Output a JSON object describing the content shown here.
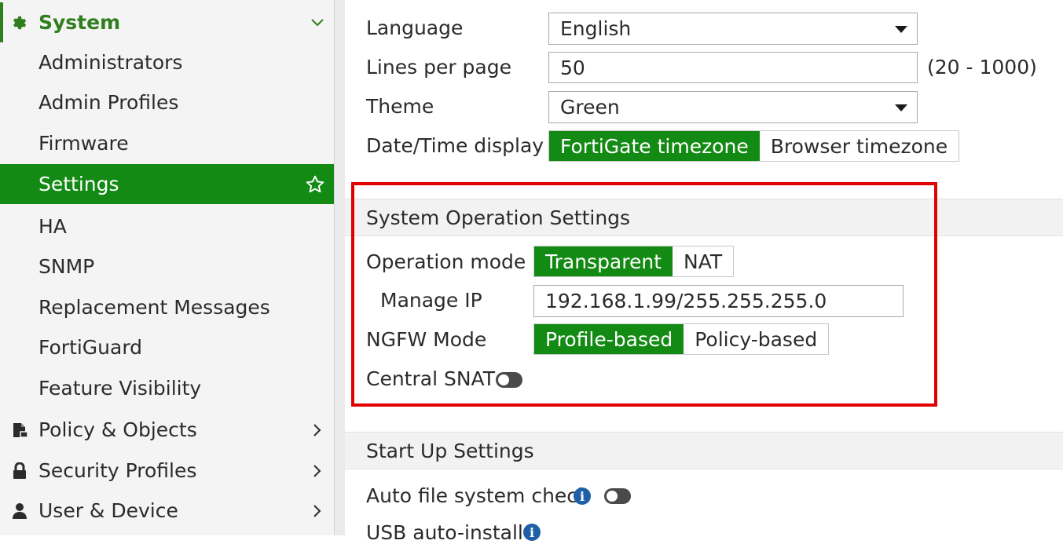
{
  "sidebar": {
    "system": {
      "label": "System",
      "icon": "gear-icon"
    },
    "items": [
      {
        "label": "Administrators"
      },
      {
        "label": "Admin Profiles"
      },
      {
        "label": "Firmware"
      },
      {
        "label": "Settings",
        "active": true
      },
      {
        "label": "HA"
      },
      {
        "label": "SNMP"
      },
      {
        "label": "Replacement Messages"
      },
      {
        "label": "FortiGuard"
      },
      {
        "label": "Feature Visibility"
      }
    ],
    "groups": [
      {
        "label": "Policy & Objects",
        "icon": "policy-icon"
      },
      {
        "label": "Security Profiles",
        "icon": "lock-icon"
      },
      {
        "label": "User & Device",
        "icon": "user-icon"
      }
    ]
  },
  "settings": {
    "language": {
      "label": "Language",
      "value": "English"
    },
    "lines_per_page": {
      "label": "Lines per page",
      "value": "50",
      "range": "(20 - 1000)"
    },
    "theme": {
      "label": "Theme",
      "value": "Green"
    },
    "datetime": {
      "label": "Date/Time display",
      "options": [
        "FortiGate timezone",
        "Browser timezone"
      ],
      "selected": "FortiGate timezone"
    }
  },
  "system_operation": {
    "title": "System Operation Settings",
    "operation_mode": {
      "label": "Operation mode",
      "options": [
        "Transparent",
        "NAT"
      ],
      "selected": "Transparent"
    },
    "manage_ip": {
      "label": "Manage IP",
      "value": "192.168.1.99/255.255.255.0"
    },
    "ngfw_mode": {
      "label": "NGFW Mode",
      "options": [
        "Profile-based",
        "Policy-based"
      ],
      "selected": "Profile-based"
    },
    "central_snat": {
      "label": "Central SNAT",
      "enabled": false
    }
  },
  "startup": {
    "title": "Start Up Settings",
    "auto_fs_check": {
      "label": "Auto file system check",
      "enabled": false
    },
    "usb_auto_install": {
      "label": "USB auto-install"
    }
  },
  "colors": {
    "accent": "#138a13",
    "highlight": "#e00000",
    "info": "#1f5fa8"
  }
}
